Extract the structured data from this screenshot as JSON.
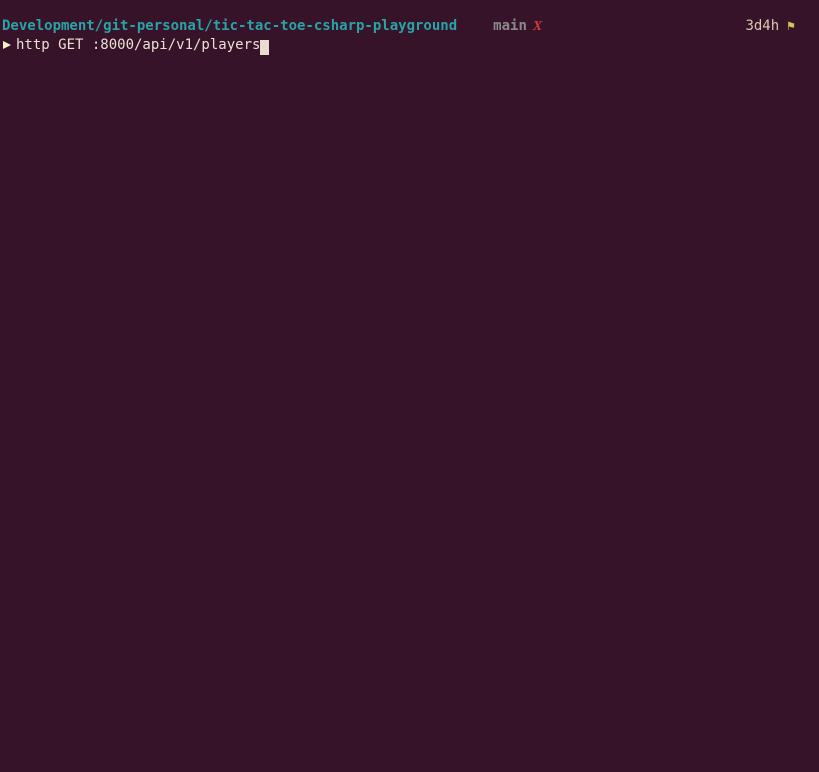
{
  "status": {
    "cwd": "Development/git-personal/tic-tac-toe-csharp-playground",
    "branch": "main",
    "dirty_marker": "X",
    "elapsed": "3d4h",
    "flag_glyph": "⚑"
  },
  "prompt": {
    "symbol_glyph": "▶",
    "command": "http GET :8000/api/v1/players"
  }
}
